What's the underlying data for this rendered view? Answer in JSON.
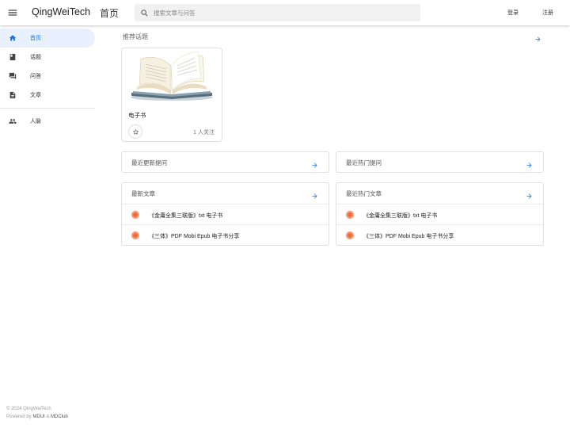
{
  "app": {
    "brand": "QingWeiTech",
    "page_title": "首页",
    "search_placeholder": "搜索文章与问答",
    "login": "登录",
    "register": "注册"
  },
  "sidebar": {
    "items": [
      {
        "label": "首页",
        "icon": "home-icon",
        "active": true
      },
      {
        "label": "话题",
        "icon": "book-icon"
      },
      {
        "label": "问答",
        "icon": "forum-icon"
      },
      {
        "label": "文章",
        "icon": "article-icon"
      },
      {
        "label": "人脉",
        "icon": "people-icon"
      }
    ]
  },
  "footer": {
    "copyright": "© 2024 QingWeiTech",
    "powered_prefix": "Powered by ",
    "powered_a": "MDUI",
    "powered_amp": " & ",
    "powered_b": "MDClub"
  },
  "recommended": {
    "title": "推荐话题",
    "topic": {
      "name": "电子书",
      "follow": "1 人关注",
      "image": "open-book-illustration"
    }
  },
  "recent_questions": {
    "title": "最近更新提问"
  },
  "hot_questions": {
    "title": "最近热门提问"
  },
  "latest_articles": {
    "title": "最新文章",
    "items": [
      "《金庸全集三联版》txt 电子书",
      "《三体》PDF Mobi Epub 电子书分享"
    ]
  },
  "hot_articles": {
    "title": "最近热门文章",
    "items": [
      "《金庸全集三联版》txt 电子书",
      "《三体》PDF Mobi Epub 电子书分享"
    ]
  },
  "colors": {
    "accent": "#1a73e8",
    "active_bg": "#e8f0fe",
    "avatar": "#ef6c3b"
  }
}
